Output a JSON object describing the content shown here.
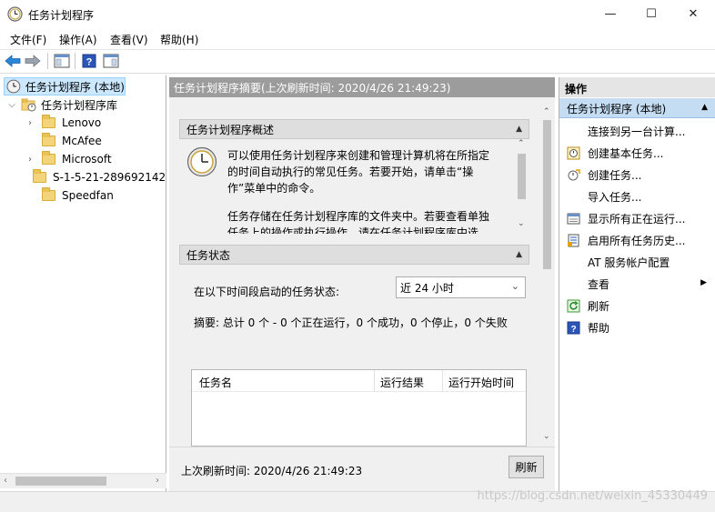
{
  "window": {
    "title": "任务计划程序",
    "minimize_glyph": "—",
    "maximize_glyph": "☐",
    "close_glyph": "✕"
  },
  "menu": [
    "文件(F)",
    "操作(A)",
    "查看(V)",
    "帮助(H)"
  ],
  "tree": {
    "root": "任务计划程序 (本地)",
    "library": "任务计划程序库",
    "children": [
      "Lenovo",
      "McAfee",
      "Microsoft",
      "S-1-5-21-289692142",
      "Speedfan"
    ]
  },
  "center": {
    "header": "任务计划程序摘要(上次刷新时间: 2020/4/26 21:49:23)",
    "overview": {
      "title": "任务计划程序概述",
      "para1_line1": "可以使用任务计划程序来创建和管理计算机将在所指定",
      "para1_line2": "的时间自动执行的常见任务。若要开始，请单击“操",
      "para1_line3": "作”菜单中的命令。",
      "para2_line1": "任务存储在任务计划程序库的文件夹中。若要查看单独",
      "para2_line2": "任务上的操作或执行操作，请在任务计划程序库中选"
    },
    "status": {
      "title": "任务状态",
      "filter_label": "在以下时间段启动的任务状态:",
      "filter_value": "近 24 小时",
      "summary": "摘要: 总计 0 个 - 0 个正在运行，0 个成功，0 个停止，0 个失败",
      "columns": [
        "任务名",
        "运行结果",
        "运行开始时间"
      ]
    },
    "footer": {
      "last_refresh": "上次刷新时间: 2020/4/26 21:49:23",
      "refresh_button": "刷新"
    }
  },
  "actions": {
    "header": "操作",
    "group": "任务计划程序 (本地)",
    "items": [
      "连接到另一台计算...",
      "创建基本任务...",
      "创建任务...",
      "导入任务...",
      "显示所有正在运行...",
      "启用所有任务历史...",
      "AT 服务帐户配置",
      "查看",
      "刷新",
      "帮助"
    ]
  },
  "watermark": "https://blog.csdn.net/weixin_45330449",
  "colors": {
    "header_gray": "#9c9c9c",
    "selection_blue": "#cce8ff",
    "accent_blue": "#0078d7"
  }
}
